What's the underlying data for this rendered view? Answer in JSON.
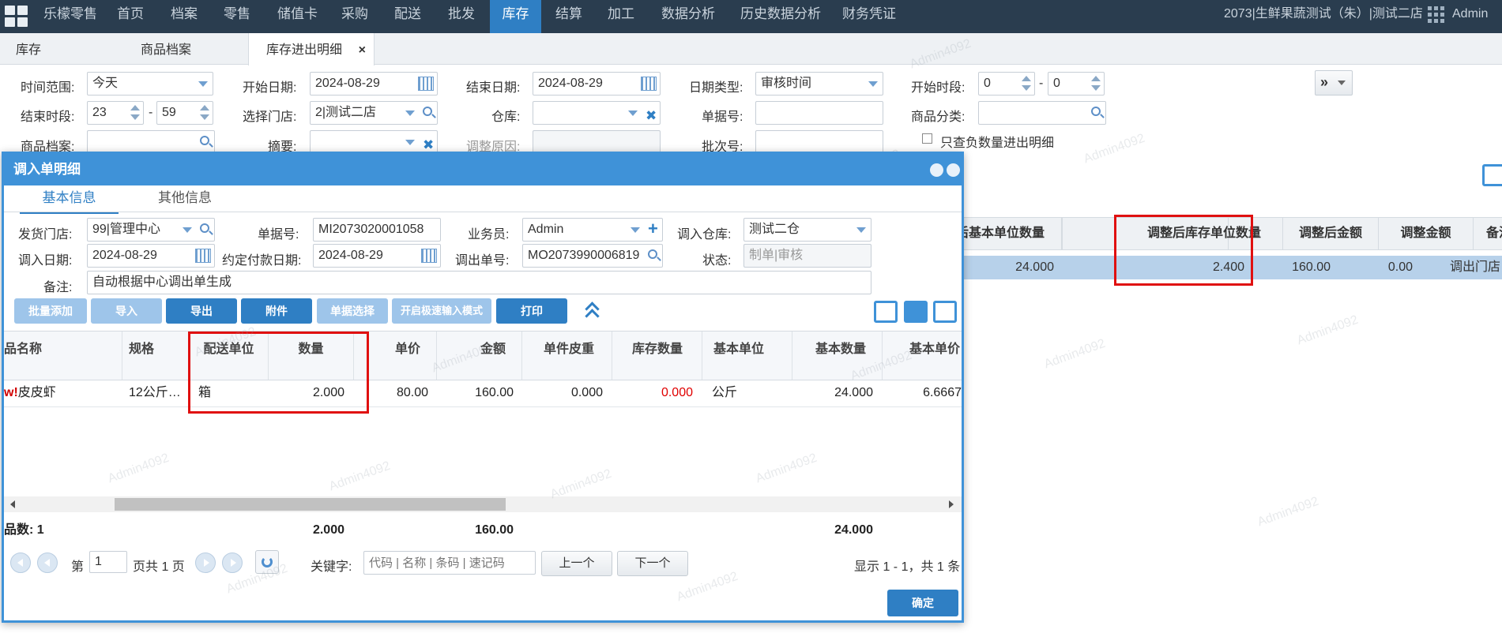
{
  "topnav": {
    "brand": "乐檬零售",
    "items": [
      "首页",
      "档案",
      "零售",
      "储值卡",
      "采购",
      "配送",
      "批发",
      "库存",
      "结算",
      "加工",
      "数据分析",
      "历史数据分析",
      "财务凭证"
    ],
    "active": "库存",
    "store": "2073|生鲜果蔬测试（朱）|测试二店",
    "user": "Admin"
  },
  "tabs": {
    "t1": "库存",
    "t2": "商品档案",
    "t3": "库存进出明细",
    "close": "×"
  },
  "filters": {
    "time_range_label": "时间范围:",
    "time_range": "今天",
    "start_date_label": "开始日期:",
    "start_date": "2024-08-29",
    "end_date_label": "结束日期:",
    "end_date": "2024-08-29",
    "date_type_label": "日期类型:",
    "date_type": "审核时间",
    "start_time_label": "开始时段:",
    "start_h": "0",
    "start_m": "0",
    "dash": "-",
    "end_time_label": "结束时段:",
    "end_h": "23",
    "end_m": "59",
    "store_label": "选择门店:",
    "store": "2|测试二店",
    "warehouse_label": "仓库:",
    "doc_no_label": "单据号:",
    "category_label": "商品分类:",
    "product_label": "商品档案:",
    "summary_label": "摘要:",
    "reason_label": "调整原因:",
    "batch_label": "批次号:",
    "negative_only": "只查负数量进出明细",
    "more": "»"
  },
  "bg_grid": {
    "headers": [
      "后基本单位数量",
      "调整后库存单位数量",
      "调整后金额",
      "调整金额",
      "备注"
    ],
    "row": [
      "24.000",
      "2.400",
      "160.00",
      "0.00",
      "调出门店"
    ]
  },
  "modal": {
    "title": "调入单明细",
    "tab_basic": "基本信息",
    "tab_other": "其他信息",
    "form": {
      "ship_store_label": "发货门店:",
      "ship_store": "99|管理中心",
      "doc_no_label": "单据号:",
      "doc_no": "MI2073020001058",
      "salesman_label": "业务员:",
      "salesman": "Admin",
      "in_wh_label": "调入仓库:",
      "in_wh": "测试二仓",
      "in_date_label": "调入日期:",
      "in_date": "2024-08-29",
      "pay_date_label": "约定付款日期:",
      "pay_date": "2024-08-29",
      "out_doc_label": "调出单号:",
      "out_doc": "MO2073990006819",
      "status_label": "状态:",
      "status": "制单|审核",
      "remark_label": "备注:",
      "remark": "自动根据中心调出单生成"
    },
    "toolbar": [
      "批量添加",
      "导入",
      "导出",
      "附件",
      "单据选择",
      "开启极速输入模式",
      "打印"
    ],
    "grid_headers": [
      "品名称",
      "规格",
      "配送单位",
      "数量",
      "单价",
      "金额",
      "单件皮重",
      "库存数量",
      "基本单位",
      "基本数量",
      "基本单价"
    ],
    "row": {
      "name_prefix": "w!",
      "name": "皮皮虾",
      "spec": "12公斤…",
      "unit": "箱",
      "qty": "2.000",
      "price": "80.00",
      "amount": "160.00",
      "tare": "0.000",
      "stock": "0.000",
      "base_unit": "公斤",
      "base_qty": "24.000",
      "base_price": "6.6667"
    },
    "footer": {
      "count": "品数: 1",
      "qty": "2.000",
      "amount": "160.00",
      "base_qty": "24.000"
    },
    "pager": {
      "page_prefix": "第",
      "page": "1",
      "page_suffix": "页共 1 页",
      "keyword_label": "关键字:",
      "keyword_placeholder": "代码 | 名称 | 条码 | 速记码",
      "prev": "上一个",
      "next": "下一个",
      "summary": "显示 1 - 1，共 1 条"
    },
    "confirm": "确定"
  },
  "watermark": "Admin4092",
  "colors": {
    "nav": "#2a3d4f",
    "accent": "#2f7fc4",
    "highlight": "#e01010"
  }
}
